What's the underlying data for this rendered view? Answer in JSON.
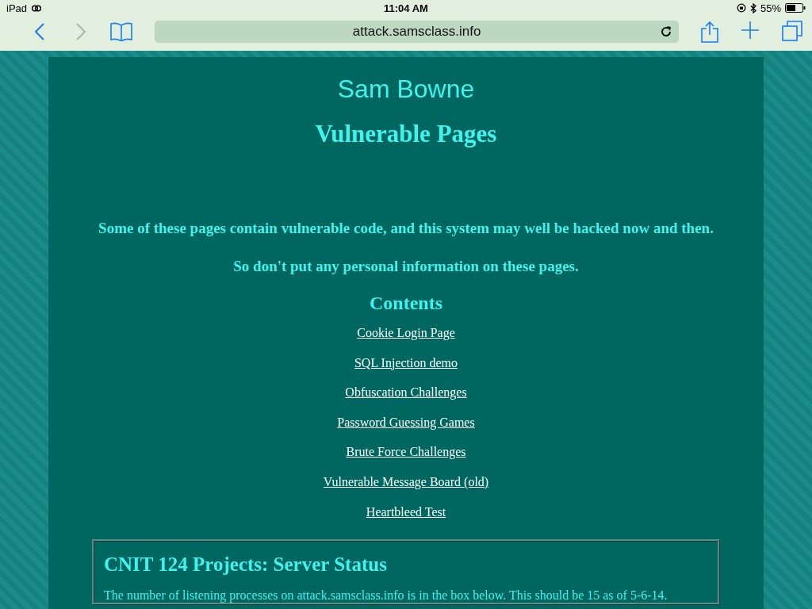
{
  "status_bar": {
    "device": "iPad",
    "time": "11:04 AM",
    "battery": "55%"
  },
  "toolbar": {
    "url": "attack.samsclass.info"
  },
  "page": {
    "site_title": "Sam Bowne",
    "heading": "Vulnerable Pages",
    "warnings": [
      "Some of these pages contain vulnerable code, and this system may well be hacked now and then.",
      "So don't put any personal information on these pages."
    ],
    "contents_heading": "Contents",
    "links": [
      "Cookie Login Page",
      "SQL Injection demo",
      "Obfuscation Challenges",
      "Password Guessing Games",
      "Brute Force Challenges",
      "Vulnerable Message Board (old)",
      "Heartbleed Test"
    ],
    "status_box": {
      "title": "CNIT 124 Projects: Server Status",
      "text": "The number of listening processes on attack.samsclass.info is in the box below. This should be 15 as of 5-6-14."
    }
  }
}
